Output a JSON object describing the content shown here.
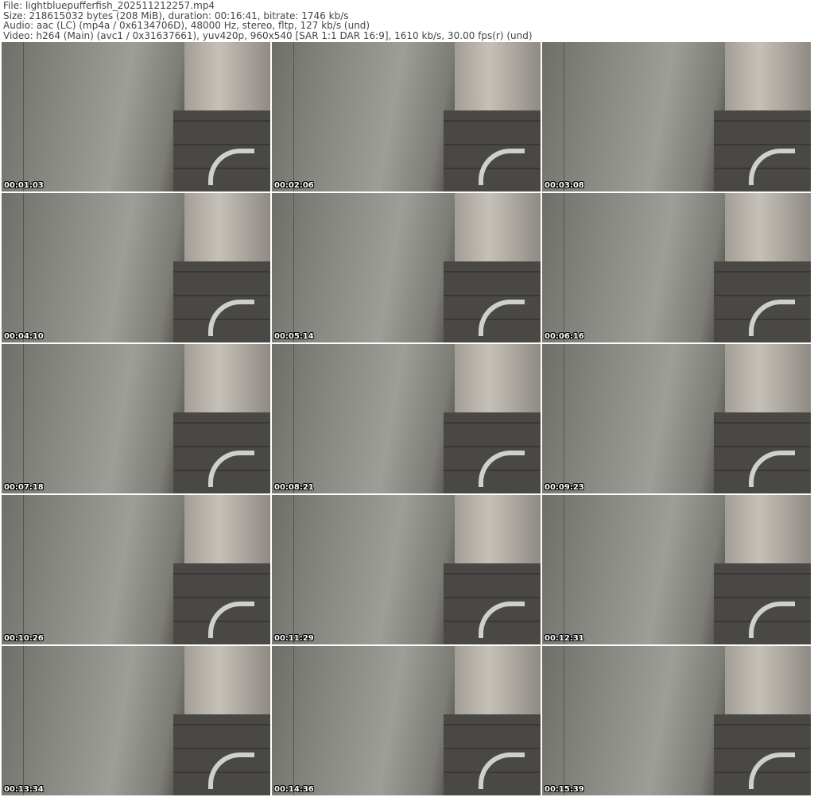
{
  "header": {
    "file": "File: lightbluepufferfish_202511212257.mp4",
    "size": "Size: 218615032 bytes (208 MiB), duration: 00:16:41, bitrate: 1746 kb/s",
    "audio": "Audio: aac (LC) (mp4a / 0x6134706D), 48000 Hz, stereo, fltp, 127 kb/s (und)",
    "video": "Video: h264 (Main) (avc1 / 0x31637661), yuv420p, 960x540 [SAR 1:1 DAR 16:9], 1610 kb/s, 30.00 fps(r) (und)"
  },
  "thumbnails": [
    {
      "timestamp": "00:01:03"
    },
    {
      "timestamp": "00:02:06"
    },
    {
      "timestamp": "00:03:08"
    },
    {
      "timestamp": "00:04:10"
    },
    {
      "timestamp": "00:05:14"
    },
    {
      "timestamp": "00:06:16"
    },
    {
      "timestamp": "00:07:18"
    },
    {
      "timestamp": "00:08:21"
    },
    {
      "timestamp": "00:09:23"
    },
    {
      "timestamp": "00:10:26"
    },
    {
      "timestamp": "00:11:29"
    },
    {
      "timestamp": "00:12:31"
    },
    {
      "timestamp": "00:13:34"
    },
    {
      "timestamp": "00:14:36"
    },
    {
      "timestamp": "00:15:39"
    }
  ]
}
